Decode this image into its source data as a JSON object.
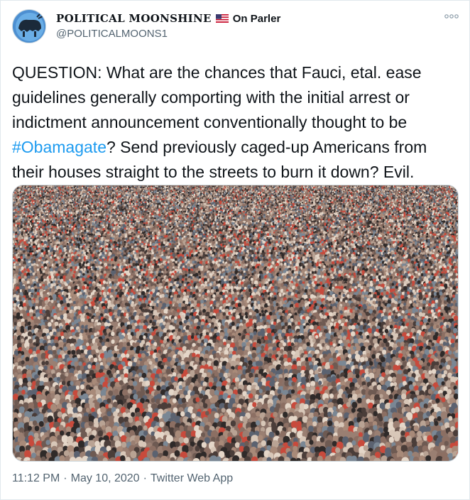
{
  "tweet": {
    "display_name": "POLITICAL MOONSHINE",
    "flag_icon": "us-flag-icon",
    "suffix": "On Parler",
    "handle": "@POLITICALMOONS1",
    "text_before": "QUESTION: What are the chances that Fauci, etal. ease guidelines generally comporting with the initial arrest or indictment announcement conventionally thought to be ",
    "hashtag": "#Obamagate",
    "text_after": "? Send previously caged-up Americans from their houses straight to the streets to burn it down? Evil.",
    "media_alt": "Aerial photo of a very large crowd of people"
  },
  "footer": {
    "time": "11:12 PM",
    "date": "May 10, 2020",
    "source": "Twitter Web App"
  },
  "colors": {
    "text": "#0f1419",
    "secondary": "#536471",
    "link": "#1d9bf0"
  }
}
